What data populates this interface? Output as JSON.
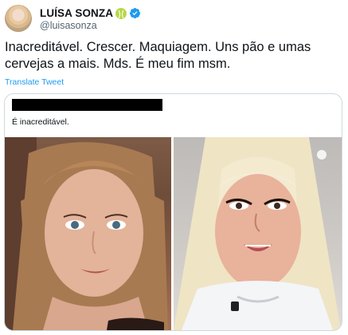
{
  "author": {
    "display_name": "LUÍSA SONZA",
    "handle": "@luisasonza",
    "badges": [
      "tennis-ball-emoji",
      "verified-badge"
    ],
    "verified_color": "#1d9bf0"
  },
  "tweet": {
    "text": "Inacreditável. Crescer. Maquiagem. Uns pão e umas cervejas a mais. Mds. É meu fim msm.",
    "translate_label": "Translate Tweet"
  },
  "quoted": {
    "author_redacted": true,
    "text": "É inacreditável.",
    "photos": [
      "photo-before",
      "photo-after"
    ]
  }
}
